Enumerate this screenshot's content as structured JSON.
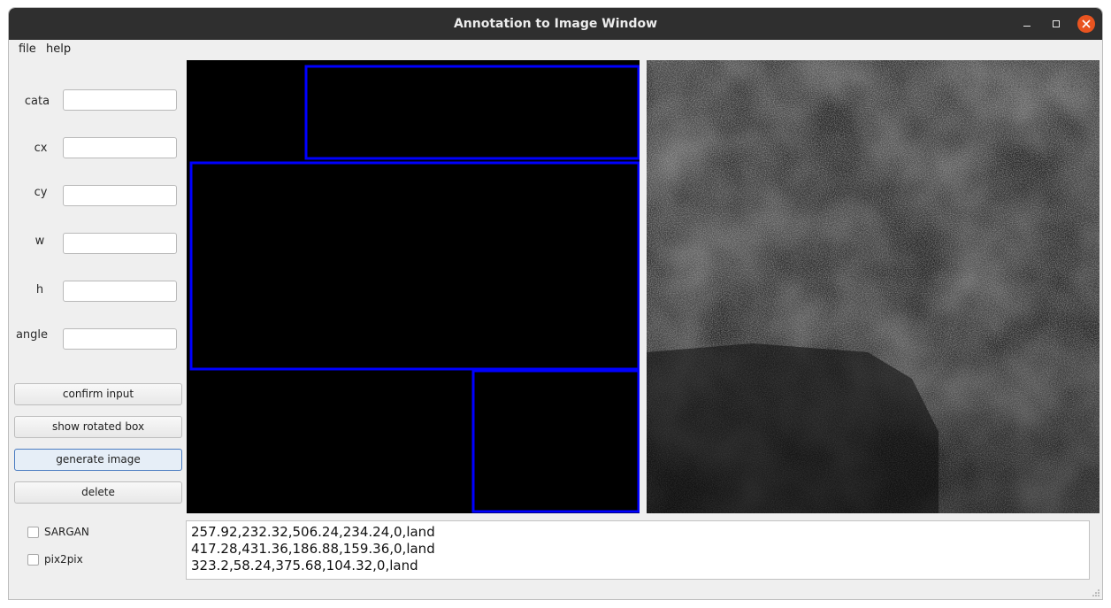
{
  "window": {
    "title": "Annotation to Image Window"
  },
  "menu": {
    "file": "file",
    "help": "help"
  },
  "fields": [
    {
      "label": "cata",
      "value": ""
    },
    {
      "label": "cx",
      "value": ""
    },
    {
      "label": "cy",
      "value": ""
    },
    {
      "label": "w",
      "value": ""
    },
    {
      "label": "h",
      "value": ""
    },
    {
      "label": "angle",
      "value": ""
    }
  ],
  "buttons": {
    "confirm": "confirm input",
    "rotated": "show rotated box",
    "generate": "generate image",
    "delete": "delete"
  },
  "checkboxes": {
    "sargan": {
      "label": "SARGAN",
      "checked": false
    },
    "pix2pix": {
      "label": "pix2pix",
      "checked": false
    }
  },
  "annotations": [
    "257.92,232.32,506.24,234.24,0,land",
    "417.28,431.36,186.88,159.36,0,land",
    "323.2,58.24,375.68,104.32,0,land"
  ],
  "colors": {
    "box_outline": "#0000ff",
    "titlebar": "#2f2f2f",
    "close_button": "#e95420"
  }
}
